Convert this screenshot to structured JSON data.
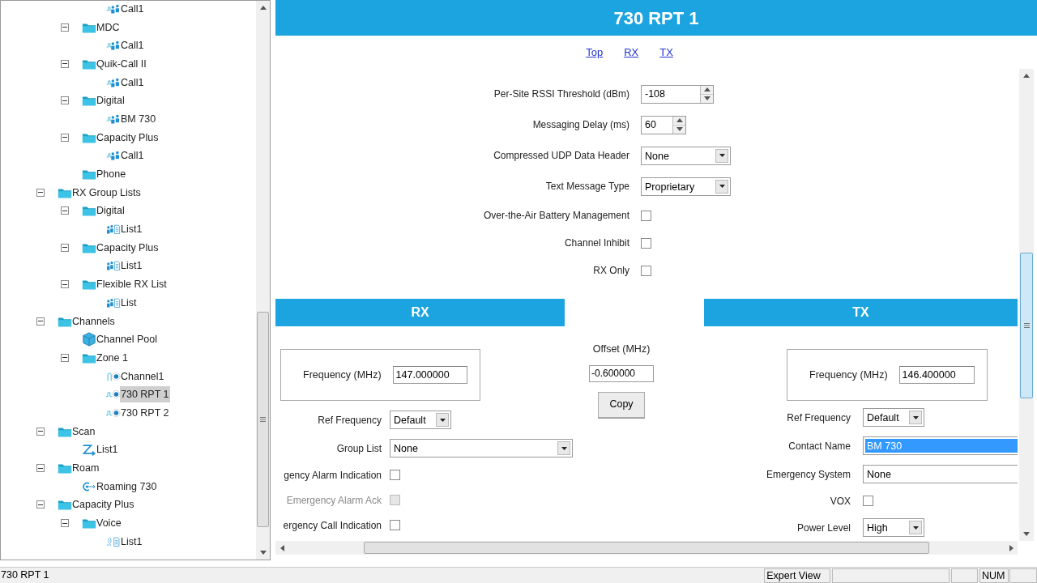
{
  "tree": {
    "items": [
      {
        "children": [
          {
            "children": [
              {
                "label": "Call1",
                "kind": "contact",
                "selected": false
              }
            ]
          },
          {
            "label": "MDC",
            "kind": "folder",
            "expanded": true,
            "selected": false,
            "children": [
              {
                "label": "Call1",
                "kind": "contact",
                "selected": false
              }
            ]
          },
          {
            "label": "Quik-Call II",
            "kind": "folder",
            "expanded": true,
            "selected": false,
            "children": [
              {
                "label": "Call1",
                "kind": "contact",
                "selected": false
              }
            ]
          },
          {
            "label": "Digital",
            "kind": "folder",
            "expanded": true,
            "selected": false,
            "children": [
              {
                "label": "BM 730",
                "kind": "contact",
                "selected": false
              }
            ]
          },
          {
            "label": "Capacity Plus",
            "kind": "folder",
            "expanded": true,
            "selected": false,
            "children": [
              {
                "label": "Call1",
                "kind": "contact",
                "selected": false
              }
            ]
          },
          {
            "label": "Phone",
            "kind": "folder",
            "selected": false
          }
        ]
      },
      {
        "label": "RX Group Lists",
        "kind": "folder",
        "expanded": true,
        "selected": false,
        "children": [
          {
            "label": "Digital",
            "kind": "folder",
            "expanded": true,
            "selected": false,
            "children": [
              {
                "label": "List1",
                "kind": "list",
                "selected": false
              }
            ]
          },
          {
            "label": "Capacity Plus",
            "kind": "folder",
            "expanded": true,
            "selected": false,
            "children": [
              {
                "label": "List1",
                "kind": "list",
                "selected": false
              }
            ]
          },
          {
            "label": "Flexible RX List",
            "kind": "folder",
            "expanded": true,
            "selected": false,
            "children": [
              {
                "label": "List",
                "kind": "list",
                "selected": false
              }
            ]
          }
        ]
      },
      {
        "label": "Channels",
        "kind": "folder",
        "expanded": true,
        "selected": false,
        "children": [
          {
            "label": "Channel Pool",
            "kind": "pool",
            "selected": false
          },
          {
            "label": "Zone 1",
            "kind": "folder",
            "expanded": true,
            "selected": false,
            "children": [
              {
                "label": "Channel1",
                "kind": "analog-channel",
                "selected": false
              },
              {
                "label": "730 RPT 1",
                "kind": "digital-channel",
                "selected": true
              },
              {
                "label": "730 RPT 2",
                "kind": "digital-channel",
                "selected": false
              }
            ]
          }
        ]
      },
      {
        "label": "Scan",
        "kind": "folder",
        "expanded": true,
        "selected": false,
        "children": [
          {
            "label": "List1",
            "kind": "scan",
            "selected": false
          }
        ]
      },
      {
        "label": "Roam",
        "kind": "folder",
        "expanded": true,
        "selected": false,
        "children": [
          {
            "label": "Roaming 730",
            "kind": "roam",
            "selected": false
          }
        ]
      },
      {
        "label": "Capacity Plus",
        "kind": "folder",
        "expanded": true,
        "selected": false,
        "children": [
          {
            "label": "Voice",
            "kind": "folder",
            "expanded": true,
            "selected": false,
            "children": [
              {
                "label": "List1",
                "kind": "voice-list",
                "selected": false
              }
            ]
          }
        ]
      }
    ]
  },
  "editor": {
    "title": "730 RPT 1",
    "links": [
      {
        "label": "Top"
      },
      {
        "label": "RX"
      },
      {
        "label": "TX"
      }
    ],
    "general": [
      {
        "kind": "spin",
        "label": "Per-Site RSSI Threshold (dBm)",
        "value": "-108"
      },
      {
        "kind": "short-spin",
        "label": "Messaging Delay (ms)",
        "value": "60"
      },
      {
        "kind": "select",
        "label": "Compressed UDP Data Header",
        "value": "None"
      },
      {
        "kind": "select",
        "label": "Text Message Type",
        "value": "Proprietary"
      },
      {
        "kind": "check",
        "label": "Over-the-Air Battery Management",
        "checked": false
      },
      {
        "kind": "check",
        "label": "Channel Inhibit",
        "checked": false
      },
      {
        "kind": "check",
        "label": "RX Only",
        "checked": false
      }
    ],
    "rx": {
      "title": "RX",
      "frequency": {
        "label": "Frequency (MHz)",
        "value": "147.000000"
      },
      "fields": [
        {
          "kind": "short-select",
          "label": "Ref Frequency",
          "value": "Default"
        },
        {
          "kind": "long-select",
          "label": "Group List",
          "value": "None"
        },
        {
          "kind": "check",
          "label": "gency Alarm Indication",
          "checked": false,
          "disabled": false
        },
        {
          "kind": "check",
          "label": "Emergency Alarm Ack",
          "checked": false,
          "disabled": true
        },
        {
          "kind": "check",
          "label": "ergency Call Indication",
          "checked": false,
          "disabled": false
        }
      ]
    },
    "offset": {
      "label": "Offset (MHz)",
      "value": "-0.600000",
      "button": "Copy"
    },
    "tx": {
      "title": "TX",
      "frequency": {
        "label": "Frequency (MHz)",
        "value": "146.400000"
      },
      "fields": [
        {
          "kind": "short-select",
          "label": "Ref Frequency",
          "value": "Default"
        },
        {
          "kind": "combo",
          "label": "Contact Name",
          "value": "BM 730",
          "highlighted": true
        },
        {
          "kind": "combo",
          "label": "Emergency System",
          "value": "None",
          "highlighted": false
        },
        {
          "kind": "check",
          "label": "VOX",
          "checked": false
        },
        {
          "kind": "short-select",
          "label": "Power Level",
          "value": "High"
        }
      ]
    }
  },
  "status_bar": {
    "message": "730 RPT 1",
    "panes": [
      "Expert View",
      "NUM"
    ]
  }
}
